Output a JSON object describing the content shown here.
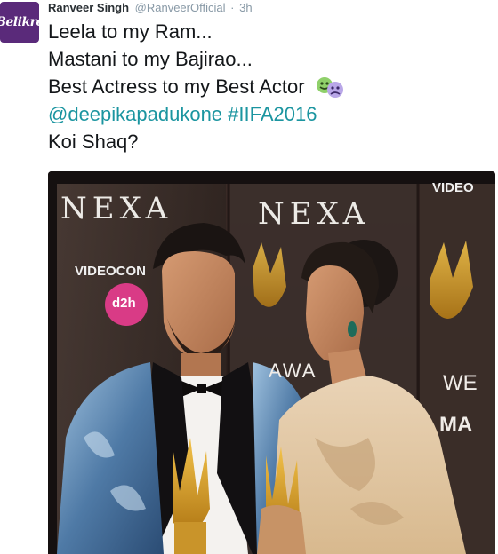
{
  "tweet": {
    "author_name": "Ranveer Singh",
    "handle": "@RanveerOfficial",
    "separator": "·",
    "timestamp": "3h",
    "avatar_text": "Belikre",
    "lines": [
      "Leela to my Ram...",
      "Mastani to my Bajirao...",
      "Best Actress to my Best Actor"
    ],
    "mention": "@deepikapadukone",
    "hashtag": "#IIFA2016",
    "last_line": "Koi Shaq?",
    "emoji": "theater-masks-emoji"
  },
  "photo": {
    "backdrop_brand_left": "NEXA",
    "backdrop_brand_center": "NEXA",
    "backdrop_logo_1": "VIDEOCON",
    "backdrop_logo_1_badge": "d2h",
    "backdrop_logo_right": "VIDEO",
    "backdrop_text_awa": "AWA",
    "backdrop_text_we": "WE",
    "backdrop_text_ma": "MA"
  },
  "colors": {
    "link": "#1b95a0",
    "name": "#292f33",
    "meta": "#8899a6"
  }
}
